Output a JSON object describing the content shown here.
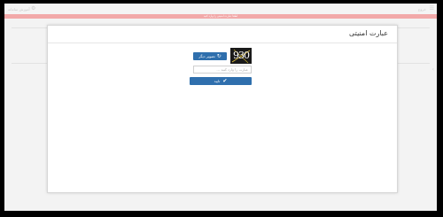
{
  "topbar": {
    "right_text": "آموزش سامانه",
    "left_text": "خروج"
  },
  "alert": {
    "text": "لطفا عبارت امنیتی را وارد کنید"
  },
  "modal": {
    "title": "عبارت امنیتی",
    "captcha_text": "930",
    "new_image_label": "تصویر دیگر",
    "input_placeholder": "عبارت را وارد کنید ...",
    "confirm_label": "تایید"
  },
  "colors": {
    "accent": "#2f6fad",
    "alert": "#f2a9a9"
  }
}
